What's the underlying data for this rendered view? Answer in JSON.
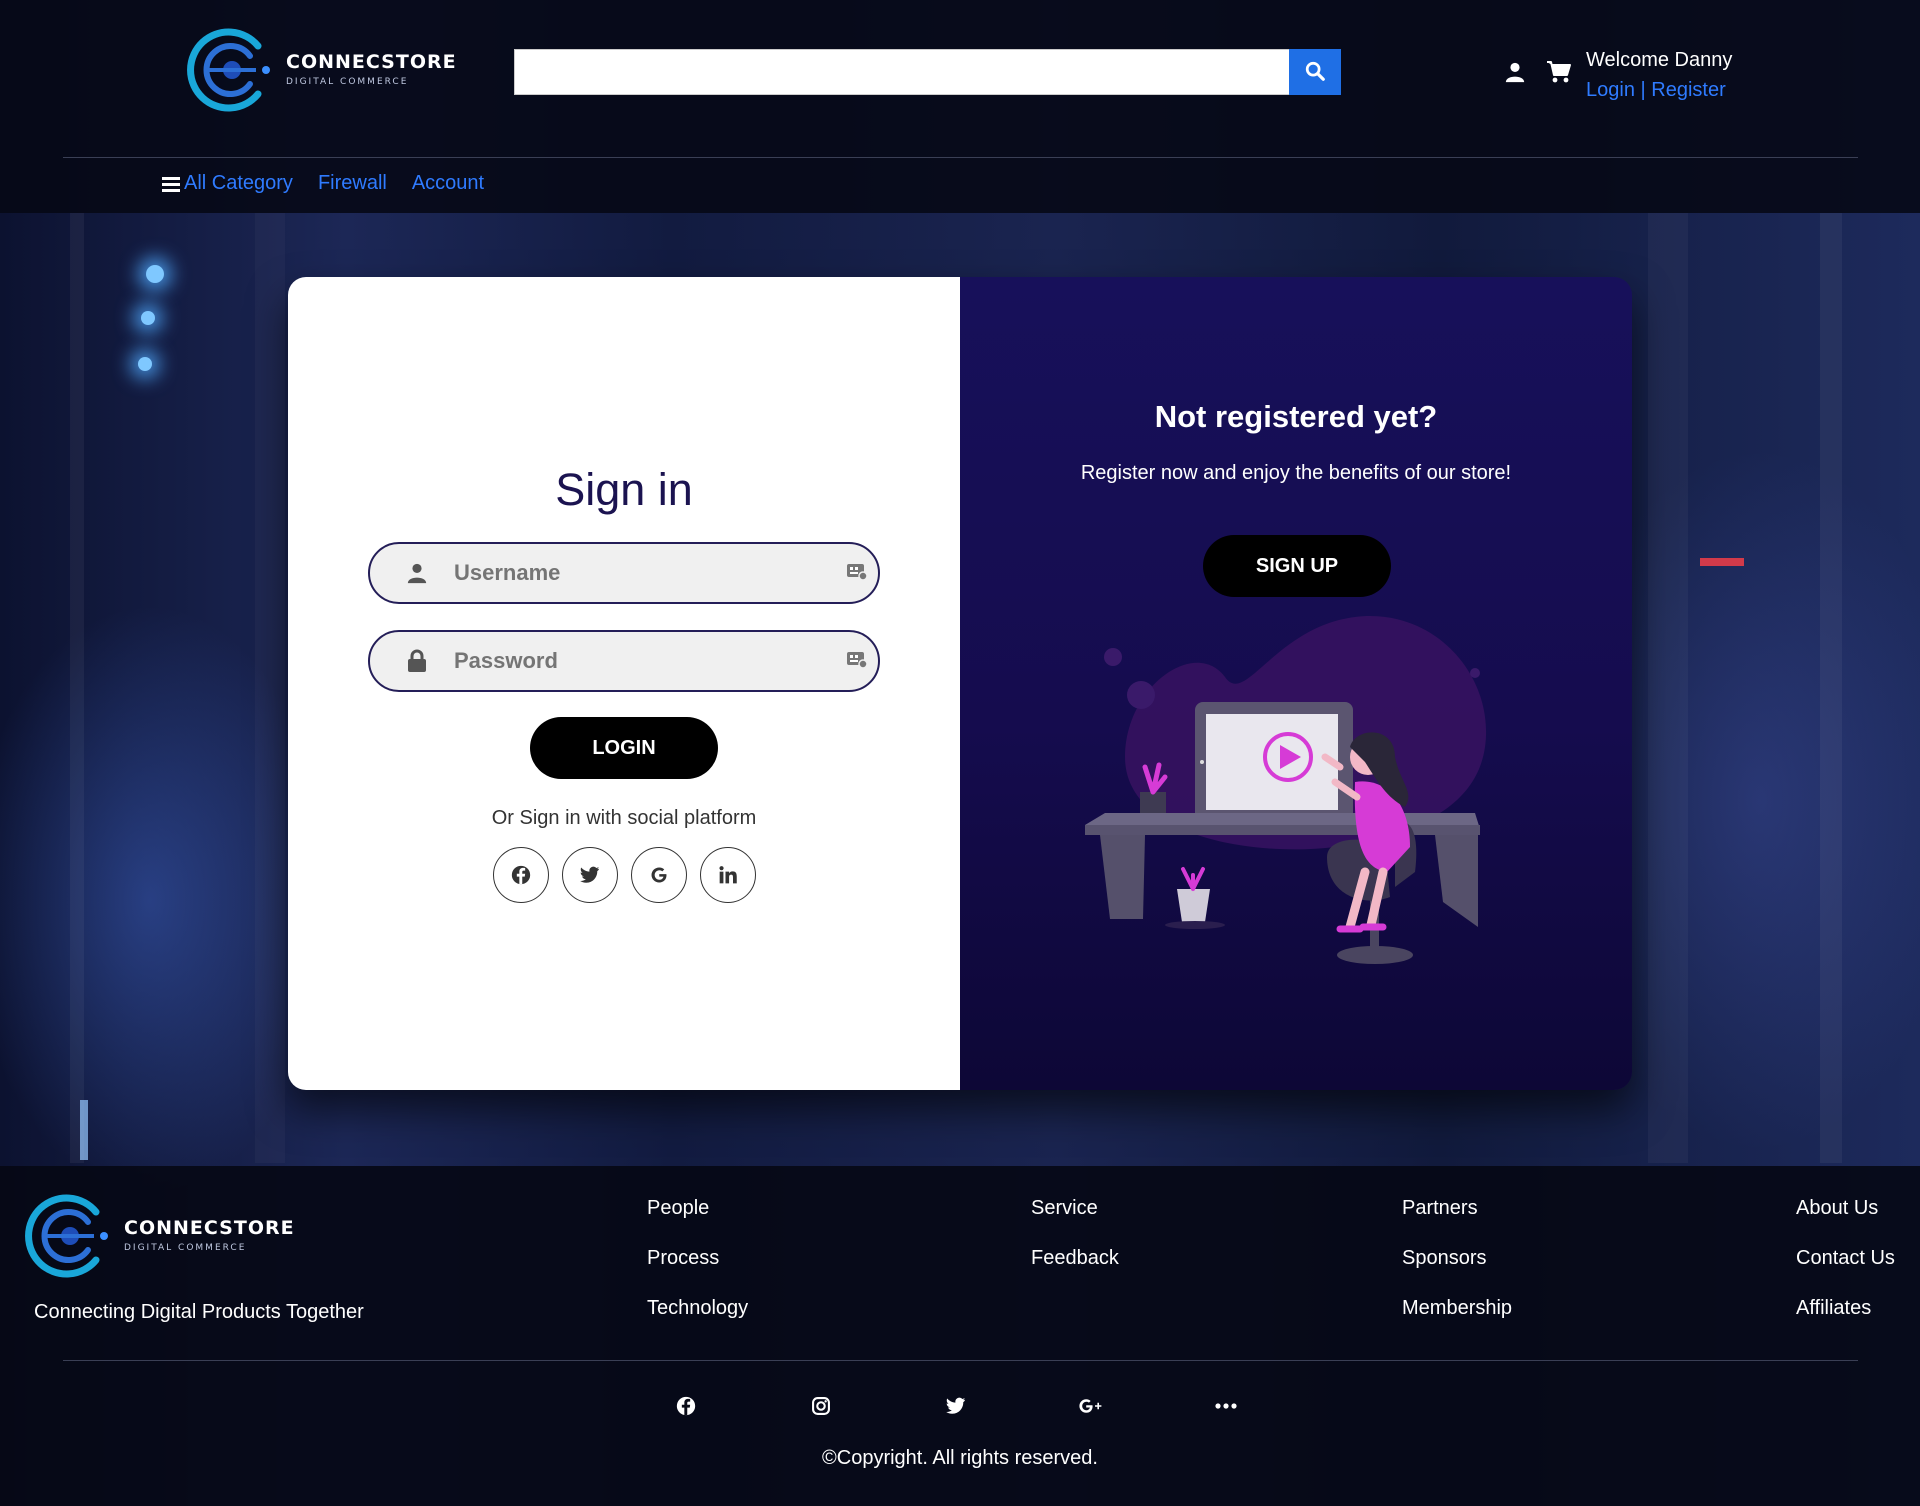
{
  "header": {
    "brand_name": "CONNECSTORE",
    "brand_sub": "DIGITAL COMMERCE",
    "search": {
      "value": "",
      "placeholder": ""
    },
    "welcome": "Welcome Danny",
    "login_link": "Login",
    "separator": "|",
    "register_link": "Register",
    "icons": [
      "user-icon",
      "cart-icon",
      "search-icon"
    ]
  },
  "nav": {
    "items": [
      {
        "label": "All Category"
      },
      {
        "label": "Firewall"
      },
      {
        "label": "Account"
      }
    ]
  },
  "signin": {
    "title": "Sign in",
    "username_placeholder": "Username",
    "password_placeholder": "Password",
    "login_label": "LOGIN",
    "social_text": "Or Sign in with social platform",
    "socials": [
      "facebook-icon",
      "twitter-icon",
      "google-icon",
      "linkedin-icon"
    ]
  },
  "register": {
    "title": "Not registered yet?",
    "text": "Register now and enjoy the benefits of our store!",
    "signup_label": "SIGN UP"
  },
  "footer": {
    "brand_name": "CONNECSTORE",
    "brand_sub": "DIGITAL COMMERCE",
    "tagline": "Connecting Digital Products Together",
    "columns": [
      {
        "links": [
          "People",
          "Process",
          "Technology"
        ]
      },
      {
        "links": [
          "Service",
          "Feedback"
        ]
      },
      {
        "links": [
          "Partners",
          "Sponsors",
          "Membership"
        ]
      },
      {
        "links": [
          "About Us",
          "Contact Us",
          "Affiliates"
        ]
      }
    ],
    "social_icons": [
      "facebook-icon",
      "instagram-icon",
      "twitter-icon",
      "google-plus-icon",
      "more-icon"
    ],
    "copyright": "©Copyright. All rights reserved."
  },
  "colors": {
    "link_blue": "#2f7bff",
    "search_button": "#1f6fe5",
    "panel_purple": "#150c4e",
    "illustration_pink": "#d63bd6"
  }
}
